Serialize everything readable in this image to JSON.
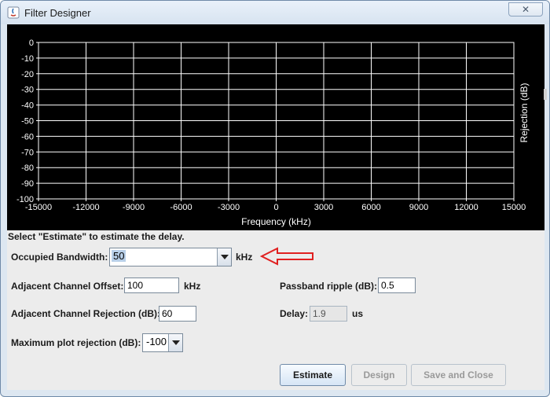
{
  "window": {
    "title": "Filter Designer",
    "close_label": "✕"
  },
  "chart_data": {
    "type": "line",
    "title": "",
    "xlabel": "Frequency (kHz)",
    "ylabel": "Rejection (dB)",
    "xlim": [
      -15000,
      15000
    ],
    "ylim": [
      -100,
      0
    ],
    "x_ticks": [
      -15000,
      -12000,
      -9000,
      -6000,
      -3000,
      0,
      3000,
      6000,
      9000,
      12000,
      15000
    ],
    "y_ticks": [
      0,
      -10,
      -20,
      -30,
      -40,
      -50,
      -60,
      -70,
      -80,
      -90,
      -100
    ],
    "grid": true,
    "series": []
  },
  "form": {
    "hint": "Select \"Estimate\" to estimate the delay.",
    "occupied_bandwidth_label": "Occupied Bandwidth:",
    "occupied_bandwidth_value": "50",
    "occupied_bandwidth_unit": "kHz",
    "adjacent_offset_label": "Adjacent Channel Offset:",
    "adjacent_offset_value": "100",
    "adjacent_offset_unit": "kHz",
    "passband_ripple_label": "Passband ripple (dB):",
    "passband_ripple_value": "0.5",
    "adjacent_rejection_label": "Adjacent Channel Rejection (dB):",
    "adjacent_rejection_value": "60",
    "delay_label": "Delay:",
    "delay_value": "1.9",
    "delay_unit": "us",
    "max_plot_rejection_label": "Maximum plot rejection (dB):",
    "max_plot_rejection_value": "-100"
  },
  "buttons": {
    "estimate": "Estimate",
    "design": "Design",
    "save_close": "Save and Close"
  },
  "colors": {
    "annotation_arrow": "#e02020",
    "chart_background": "#000000",
    "grid": "#ffffff"
  }
}
